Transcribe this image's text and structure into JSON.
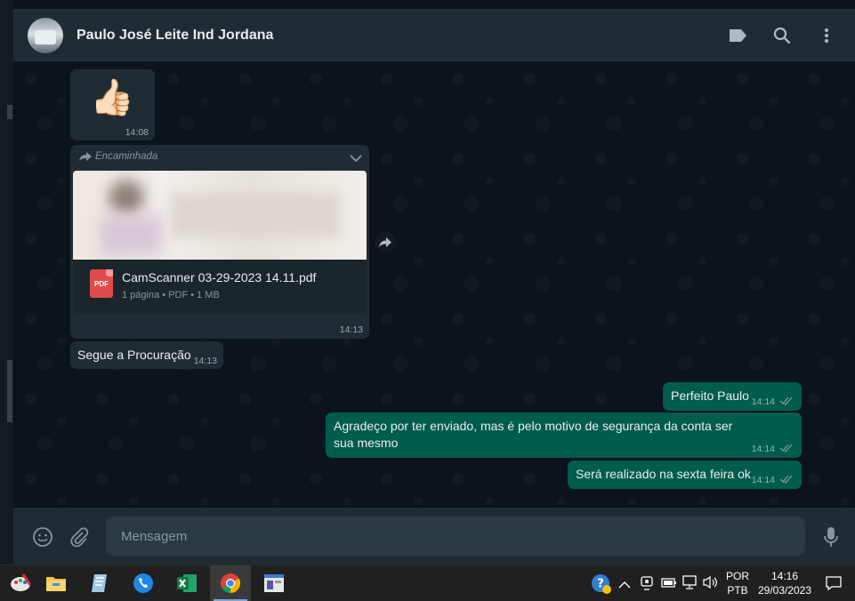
{
  "header": {
    "contact_name": "Paulo José Leite Ind Jordana",
    "icons": [
      "label-icon",
      "search-icon",
      "menu-icon"
    ]
  },
  "messages": {
    "thumbs_up": {
      "emoji": "👍🏻",
      "time": "14:08"
    },
    "document": {
      "forwarded_label": "Encaminhada",
      "file_name": "CamScanner 03-29-2023 14.11.pdf",
      "file_meta": "1 página • PDF • 1 MB",
      "pdf_badge": "PDF",
      "time": "14:13"
    },
    "incoming_text": {
      "text": "Segue a Procuração",
      "time": "14:13"
    },
    "outgoing": [
      {
        "text": "Perfeito Paulo",
        "time": "14:14"
      },
      {
        "text": "Agradeço por ter enviado, mas é pelo motivo de segurança da conta ser sua mesmo",
        "time": "14:14"
      },
      {
        "text": "Será realizado na sexta feira ok",
        "time": "14:14"
      }
    ]
  },
  "composer": {
    "placeholder": "Mensagem"
  },
  "taskbar": {
    "apps": [
      "paint-app",
      "file-explorer-app",
      "notepad-app",
      "phone-app",
      "excel-app",
      "chrome-app",
      "window-app"
    ],
    "language": "POR",
    "layout": "PTB",
    "time": "14:16",
    "date": "29/03/2023"
  },
  "colors": {
    "header_bg": "#202c33",
    "chat_bg": "#0b141a",
    "incoming_bubble": "#202c33",
    "outgoing_bubble": "#005c4b",
    "taskbar_bg": "#202020"
  }
}
